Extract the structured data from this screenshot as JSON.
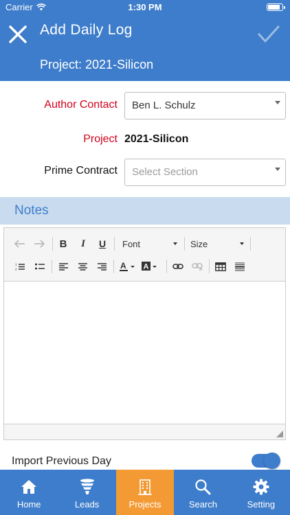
{
  "status_bar": {
    "carrier": "Carrier",
    "time": "1:30 PM"
  },
  "header": {
    "title": "Add Daily Log",
    "subtitle": "Project: 2021-Silicon"
  },
  "form": {
    "author_label": "Author Contact",
    "author_value": "Ben L. Schulz",
    "project_label": "Project",
    "project_value": "2021-Silicon",
    "prime_label": "Prime Contract",
    "prime_placeholder": "Select Section"
  },
  "notes": {
    "title": "Notes",
    "toolbar": {
      "font_label": "Font",
      "size_label": "Size"
    },
    "content": ""
  },
  "import_previous_day": {
    "label": "Import Previous Day",
    "enabled": true
  },
  "tabbar": {
    "items": [
      {
        "label": "Home",
        "icon": "home-icon"
      },
      {
        "label": "Leads",
        "icon": "funnel-icon"
      },
      {
        "label": "Projects",
        "icon": "building-icon",
        "active": true
      },
      {
        "label": "Search",
        "icon": "search-icon"
      },
      {
        "label": "Setting",
        "icon": "gear-icon"
      }
    ]
  },
  "colors": {
    "primary": "#3e7dcb",
    "active_tab": "#f39a34",
    "label_red": "#d0021b",
    "notes_bg": "#c9dcef"
  }
}
